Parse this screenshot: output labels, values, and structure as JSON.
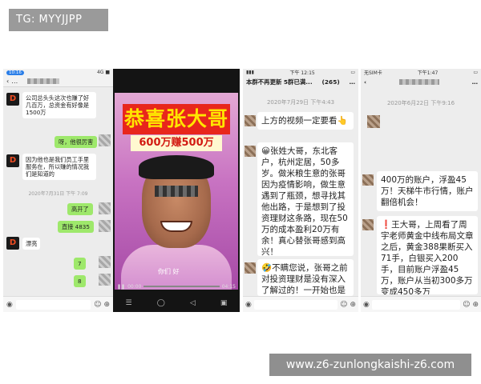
{
  "watermark": {
    "tg_label": "TG: MYYJJPP",
    "site_label": "www.z6-zunlongkaishi-z6.com"
  },
  "panel1": {
    "status_time": "10:16",
    "status_right": "4G ■",
    "messages": [
      {
        "side": "left",
        "text": "公司总头头这次也赚了好几百万，总资金有好像是1500万"
      },
      {
        "side": "right",
        "text": "呀，他很厉害"
      },
      {
        "side": "left",
        "text": "因为他也是我们员工手里服务在，所以赚的情况我们是知道的"
      },
      {
        "side": "right",
        "text": "高开了"
      },
      {
        "side": "right",
        "text": "直接 4835"
      },
      {
        "side": "left",
        "text": "漂亮"
      },
      {
        "side": "right",
        "text": "7"
      },
      {
        "side": "right",
        "text": "8"
      }
    ],
    "timestamp": "2020年7月31日 下午 7:09",
    "avatar_letter": "D"
  },
  "panel2": {
    "banner_title": "恭喜张大哥",
    "banner_subtitle": "600万赚500万",
    "video_caption": "你们 好",
    "time_elapsed": "00:00",
    "time_total": "04:15"
  },
  "panel3": {
    "status_time": "下午 12:15",
    "header": "本群不再更新 5群已满...",
    "count": "(265)",
    "timestamp": "2020年7月29日 下午4:43",
    "intro": "上方的视频一定要看👆",
    "story": "😀张姓大哥，东北客户，杭州定居，50多岁。做米粮生意的张哥因为疫情影响，做生意遇到了瓶颈，想寻找其他出路，于是想到了投资理财这条路，现在50万的成本盈利20万有余！真心替张哥感到高兴！",
    "story2": "🤣不瞒您说，张哥之前对投资理财是没有深入了解过的！一开始也是"
  },
  "panel4": {
    "status_left": "无SIM卡",
    "status_time": "下午1:47",
    "timestamp": "2020年6月22日 下午9:16",
    "card1": "400万的账户，浮盈45万！天梯牛市行情，账户翻倍机会！",
    "card2": "❗王大哥，上周看了周宇老师黄金中线布局文章之后，黄金388果断买入71手，白银买入200手，目前账户浮盈45万，账户从当初300多万变成450多万"
  }
}
